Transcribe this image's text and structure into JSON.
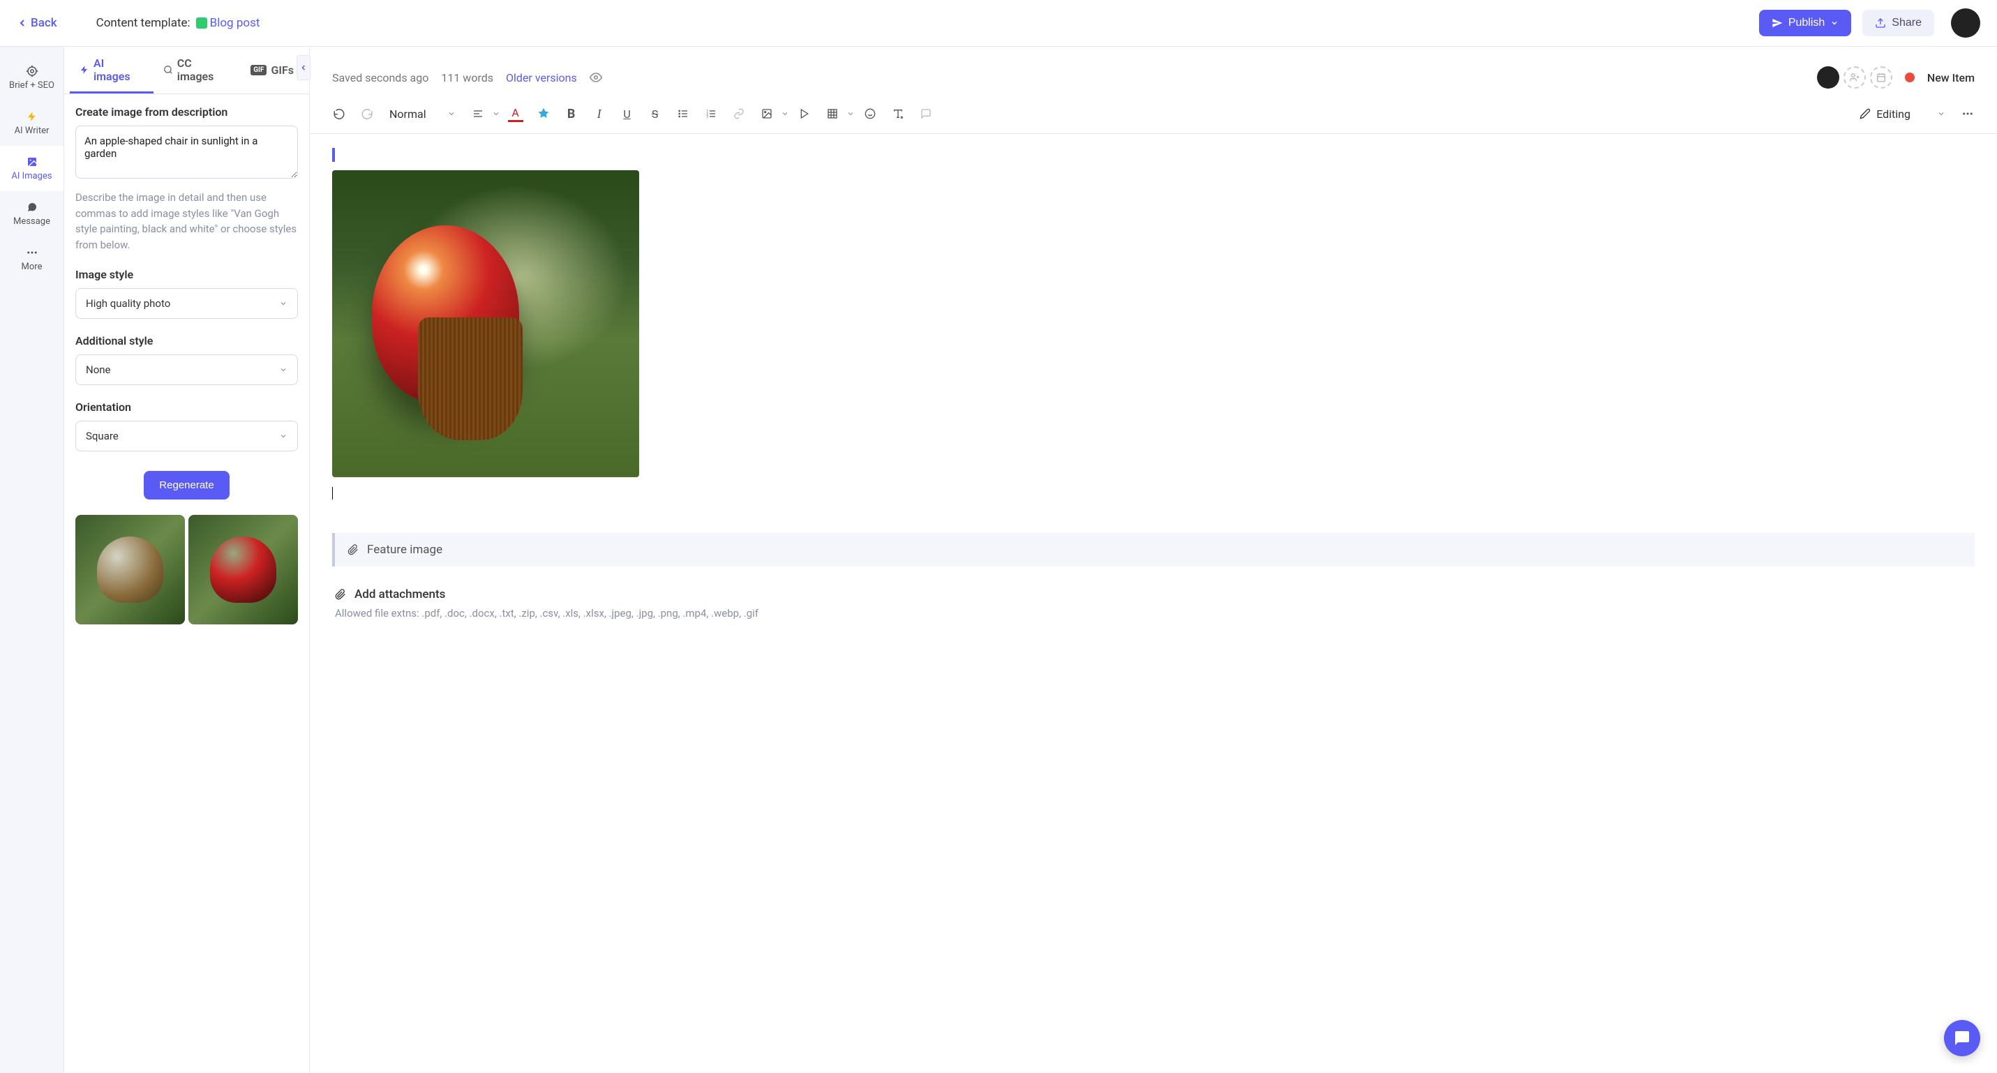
{
  "header": {
    "back_label": "Back",
    "template_prefix": "Content template:",
    "template_link": "Blog post",
    "publish_label": "Publish",
    "share_label": "Share"
  },
  "nav": {
    "brief": "Brief + SEO",
    "writer": "AI Writer",
    "images": "AI Images",
    "message": "Message",
    "more": "More"
  },
  "panel": {
    "tabs": {
      "ai_images": "AI images",
      "cc_images": "CC images",
      "gifs": "GIFs"
    },
    "prompt_label": "Create image from description",
    "prompt_value": "An apple-shaped chair in sunlight in a garden",
    "prompt_hint": "Describe the image in detail and then use commas to add image styles like \"Van Gogh style painting, black and white\" or choose styles from below.",
    "style_label": "Image style",
    "style_value": "High quality photo",
    "add_style_label": "Additional style",
    "add_style_value": "None",
    "orientation_label": "Orientation",
    "orientation_value": "Square",
    "regenerate_label": "Regenerate"
  },
  "editor": {
    "saved_label": "Saved seconds ago",
    "word_count": "111 words",
    "older_versions": "Older versions",
    "status_label": "New Item",
    "format_select": "Normal",
    "editing_mode": "Editing"
  },
  "feature_image": {
    "label": "Feature image"
  },
  "attachments": {
    "label": "Add attachments",
    "extensions_hint": "Allowed file extns: .pdf, .doc, .docx, .txt, .zip, .csv, .xls, .xlsx, .jpeg, .jpg, .png, .mp4, .webp, .gif"
  }
}
